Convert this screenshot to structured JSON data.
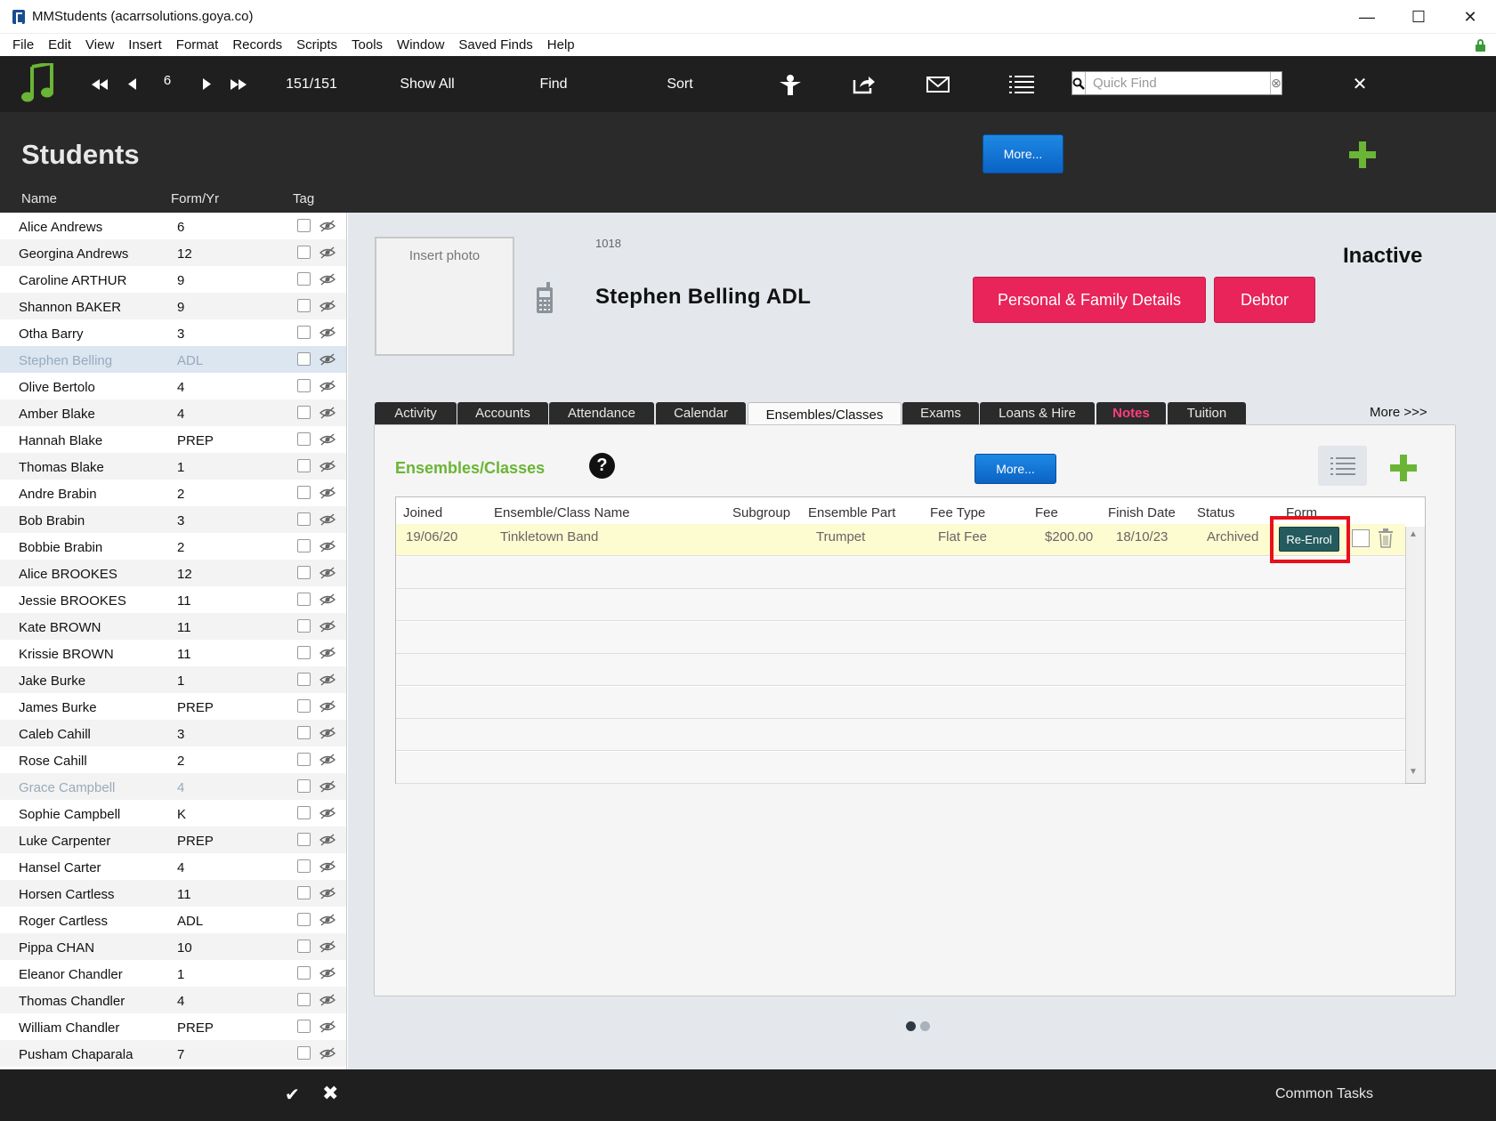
{
  "window": {
    "title": "MMStudents (acarrsolutions.goya.co)",
    "minimize": "—",
    "maximize": "☐",
    "close": "✕"
  },
  "menu": [
    "File",
    "Edit",
    "View",
    "Insert",
    "Format",
    "Records",
    "Scripts",
    "Tools",
    "Window",
    "Saved Finds",
    "Help"
  ],
  "toolbar": {
    "record_number": "6",
    "record_count": "151/151",
    "show_all": "Show All",
    "find": "Find",
    "sort": "Sort",
    "quick_find_placeholder": "Quick Find"
  },
  "header": {
    "title": "Students",
    "more_button": "More...",
    "col_name": "Name",
    "col_form": "Form/Yr",
    "col_tag": "Tag"
  },
  "students": [
    {
      "name": "Alice Andrews",
      "form": "6"
    },
    {
      "name": "Georgina Andrews",
      "form": "12"
    },
    {
      "name": "Caroline ARTHUR",
      "form": "9"
    },
    {
      "name": "Shannon BAKER",
      "form": "9"
    },
    {
      "name": "Otha Barry",
      "form": "3"
    },
    {
      "name": "Stephen Belling",
      "form": "ADL"
    },
    {
      "name": "Olive Bertolo",
      "form": "4"
    },
    {
      "name": "Amber Blake",
      "form": "4"
    },
    {
      "name": "Hannah Blake",
      "form": "PREP"
    },
    {
      "name": "Thomas Blake",
      "form": "1"
    },
    {
      "name": "Andre Brabin",
      "form": "2"
    },
    {
      "name": "Bob Brabin",
      "form": "3"
    },
    {
      "name": "Bobbie Brabin",
      "form": "2"
    },
    {
      "name": "Alice BROOKES",
      "form": "12"
    },
    {
      "name": "Jessie BROOKES",
      "form": "11"
    },
    {
      "name": "Kate BROWN",
      "form": "11"
    },
    {
      "name": "Krissie BROWN",
      "form": "11"
    },
    {
      "name": "Jake Burke",
      "form": "1"
    },
    {
      "name": "James Burke",
      "form": "PREP"
    },
    {
      "name": "Caleb Cahill",
      "form": "3"
    },
    {
      "name": "Rose Cahill",
      "form": "2"
    },
    {
      "name": "Grace Campbell",
      "form": "4"
    },
    {
      "name": "Sophie Campbell",
      "form": "K"
    },
    {
      "name": "Luke Carpenter",
      "form": "PREP"
    },
    {
      "name": "Hansel Carter",
      "form": "4"
    },
    {
      "name": "Horsen Cartless",
      "form": "11"
    },
    {
      "name": "Roger Cartless",
      "form": "ADL"
    },
    {
      "name": "Pippa CHAN",
      "form": "10"
    },
    {
      "name": "Eleanor Chandler",
      "form": "1"
    },
    {
      "name": "Thomas Chandler",
      "form": "4"
    },
    {
      "name": "William Chandler",
      "form": "PREP"
    },
    {
      "name": "Pusham Chaparala",
      "form": "7"
    }
  ],
  "record": {
    "photo_label": "Insert photo",
    "id": "1018",
    "name": "Stephen Belling  ADL",
    "status": "Inactive",
    "personal_button": "Personal & Family Details",
    "debtor_button": "Debtor"
  },
  "tabs": [
    "Activity",
    "Accounts",
    "Attendance",
    "Calendar",
    "Ensembles/Classes",
    "Exams",
    "Loans & Hire",
    "Notes",
    "Tuition"
  ],
  "more_tabs": "More >>>",
  "panel": {
    "title": "Ensembles/Classes",
    "help": "?",
    "more_button": "More...",
    "columns": [
      "Joined",
      "Ensemble/Class Name",
      "Subgroup",
      "Ensemble Part",
      "Fee Type",
      "Fee",
      "Finish Date",
      "Status",
      "Form"
    ],
    "row": {
      "joined": "19/06/20",
      "name": "Tinkletown Band",
      "subgroup": "",
      "part": "Trumpet",
      "fee_type": "Flat Fee",
      "fee": "$200.00",
      "finish": "18/10/23",
      "status": "Archived",
      "action": "Re-Enrol"
    }
  },
  "footer": {
    "ok": "✔",
    "cancel": "✖",
    "common_tasks": "Common Tasks"
  },
  "colors": {
    "accent_green": "#6ab535",
    "pink": "#e8245a",
    "blue": "#1e88e5",
    "highlight": "#e8101a"
  }
}
